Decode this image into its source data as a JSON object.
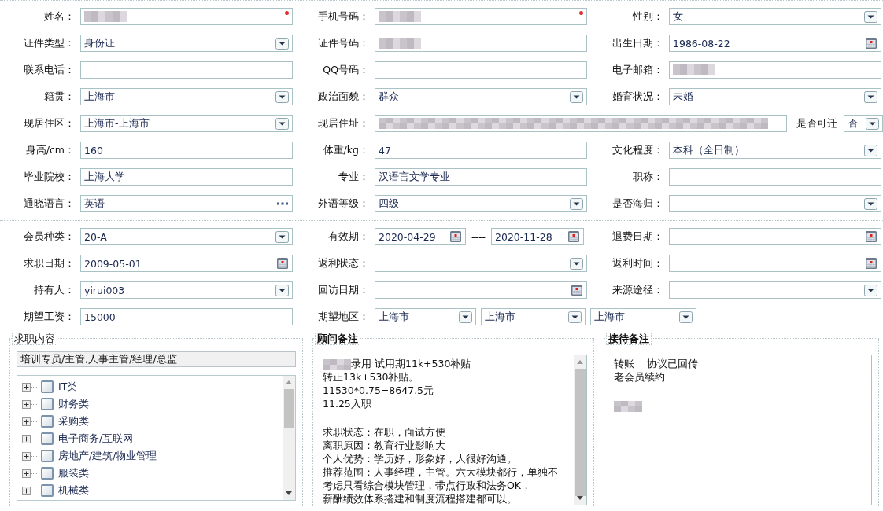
{
  "sections": [
    {
      "rows": [
        [
          {
            "label": "姓名：",
            "kind": "text",
            "redacted": true,
            "required": true
          },
          {
            "label": "手机号码：",
            "kind": "text",
            "redacted": true,
            "required": true
          },
          {
            "label": "性别：",
            "kind": "select",
            "value": "女"
          }
        ],
        [
          {
            "label": "证件类型：",
            "kind": "select",
            "value": "身份证"
          },
          {
            "label": "证件号码：",
            "kind": "text",
            "redacted": true
          },
          {
            "label": "出生日期：",
            "kind": "date",
            "value": "1986-08-22"
          }
        ],
        [
          {
            "label": "联系电话：",
            "kind": "text"
          },
          {
            "label": "QQ号码：",
            "kind": "text"
          },
          {
            "label": "电子邮箱：",
            "kind": "text",
            "redacted": true
          }
        ],
        [
          {
            "label": "籍贯：",
            "kind": "select",
            "value": "上海市"
          },
          {
            "label": "政治面貌：",
            "kind": "select",
            "value": "群众"
          },
          {
            "label": "婚育状况：",
            "kind": "select",
            "value": "未婚"
          }
        ],
        [
          {
            "label": "现居住区：",
            "kind": "select",
            "value": "上海市-上海市"
          },
          {
            "label": "现居住址：",
            "kind": "address",
            "redacted": true,
            "extra": {
              "label": "是否可迁",
              "value": "否"
            }
          }
        ],
        [
          {
            "label": "身高/cm：",
            "kind": "text",
            "value": "160"
          },
          {
            "label": "体重/kg：",
            "kind": "text",
            "value": "47"
          },
          {
            "label": "文化程度：",
            "kind": "select",
            "value": "本科（全日制）"
          }
        ],
        [
          {
            "label": "毕业院校：",
            "kind": "text",
            "value": "上海大学"
          },
          {
            "label": "专业：",
            "kind": "text",
            "value": "汉语言文学专业"
          },
          {
            "label": "职称：",
            "kind": "text"
          }
        ],
        [
          {
            "label": "通晓语言：",
            "kind": "lookup",
            "value": "英语"
          },
          {
            "label": "外语等级：",
            "kind": "select",
            "value": "四级"
          },
          {
            "label": "是否海归：",
            "kind": "select"
          }
        ]
      ]
    },
    {
      "rows": [
        [
          {
            "label": "会员种类：",
            "kind": "select",
            "value": "20-A"
          },
          {
            "label": "有效期：",
            "kind": "daterange",
            "values": [
              "2020-04-29",
              "2020-11-28"
            ],
            "separator": "----"
          },
          {
            "label": "退费日期：",
            "kind": "date"
          }
        ],
        [
          {
            "label": "求职日期：",
            "kind": "date",
            "value": "2009-05-01"
          },
          {
            "label": "返利状态：",
            "kind": "select"
          },
          {
            "label": "返利时间：",
            "kind": "date"
          }
        ],
        [
          {
            "label": "持有人：",
            "kind": "select",
            "value": "yirui003"
          },
          {
            "label": "回访日期：",
            "kind": "date"
          },
          {
            "label": "来源途径：",
            "kind": "select"
          }
        ],
        [
          {
            "label": "期望工资：",
            "kind": "text",
            "value": "15000"
          },
          {
            "label": "期望地区：",
            "kind": "regions",
            "values": [
              "上海市",
              "上海市",
              "上海市"
            ]
          }
        ]
      ]
    }
  ],
  "panels": [
    {
      "kind": "tree",
      "legend": "求职内容",
      "summary": "培训专员/主管,人事主管/经理/总监",
      "items": [
        {
          "label": "IT类",
          "checked": false,
          "expanded": false
        },
        {
          "label": "财务类",
          "checked": false,
          "expanded": false
        },
        {
          "label": "采购类",
          "checked": false,
          "expanded": false
        },
        {
          "label": "电子商务/互联网",
          "checked": false,
          "expanded": false
        },
        {
          "label": "房地产/建筑/物业管理",
          "checked": false,
          "expanded": false
        },
        {
          "label": "服装类",
          "checked": false,
          "expanded": false
        },
        {
          "label": "机械类",
          "checked": false,
          "expanded": false
        }
      ]
    },
    {
      "kind": "notes",
      "legend": "顾问备注",
      "scrollbar": true,
      "lines": [
        {
          "redacted": true,
          "text": "录用 试用期11k+530补贴"
        },
        {
          "text": "转正13k+530补贴。"
        },
        {
          "text": "11530*0.75=8647.5元"
        },
        {
          "text": "11.25入职"
        },
        {
          "kind": "blank"
        },
        {
          "text": "求职状态：在职，面试方便"
        },
        {
          "text": "离职原因：教育行业影响大"
        },
        {
          "text": "个人优势：学历好，形象好，人很好沟通。"
        },
        {
          "text": "推荐范围：人事经理，主管。六大模块都行，单独不"
        },
        {
          "text": "考虑只看综合模块管理，带点行政和法务OK，"
        },
        {
          "text": "薪酬绩效体系搭建和制度流程搭建都可以。"
        }
      ]
    },
    {
      "kind": "notes",
      "legend": "接待备注",
      "scrollbar": false,
      "lines": [
        {
          "text": "转账    协议已回传"
        },
        {
          "text": "老会员续约"
        },
        {
          "kind": "blank"
        },
        {
          "redacted": true
        }
      ]
    }
  ]
}
